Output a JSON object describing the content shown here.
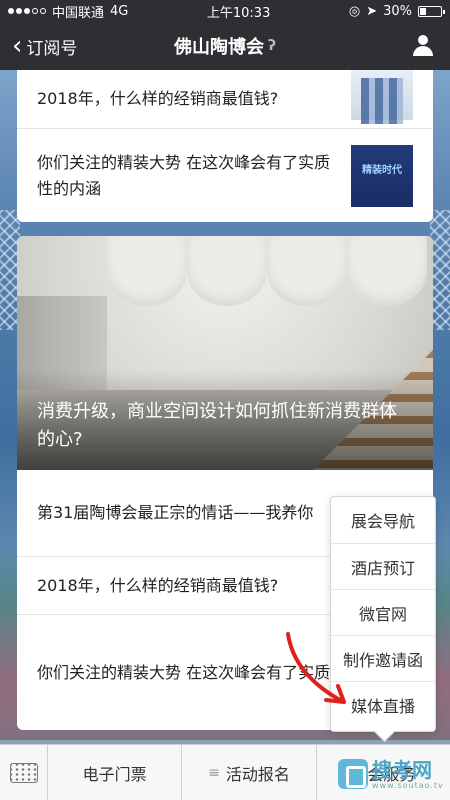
{
  "status_bar": {
    "carrier": "中国联通",
    "network": "4G",
    "time": "上午10:33",
    "battery": "30%",
    "battery_level": 0.3
  },
  "nav": {
    "back_label": "订阅号",
    "title": "佛山陶博会"
  },
  "articles_top": [
    {
      "title": "2018年，什么样的经销商最值钱?",
      "thumb": "business-figures"
    },
    {
      "title": "你们关注的精装大势 在这次峰会有了实质性的内涵",
      "thumb": "event-poster",
      "thumb_text": "精装时代"
    }
  ],
  "hero": {
    "title": "消费升级，商业空间设计如何抓住新消费群体的心?"
  },
  "articles_bottom": [
    {
      "title": "第31届陶博会最正宗的情话——我养你"
    },
    {
      "title": "2018年，什么样的经销商最值钱?"
    },
    {
      "title": "你们关注的精装大势 在这次峰会有了实质性的内涵"
    }
  ],
  "popup_menu": {
    "items": [
      "展会导航",
      "酒店预订",
      "微官网",
      "制作邀请函",
      "媒体直播"
    ]
  },
  "bottom_menu": {
    "items": [
      "电子门票",
      "活动报名",
      "展会服务"
    ]
  },
  "watermark": {
    "main": "搜考网",
    "sub": "www.soutao.tv"
  },
  "colors": {
    "nav_bg": "#2e2e33",
    "annotation_arrow": "#e0201c"
  }
}
